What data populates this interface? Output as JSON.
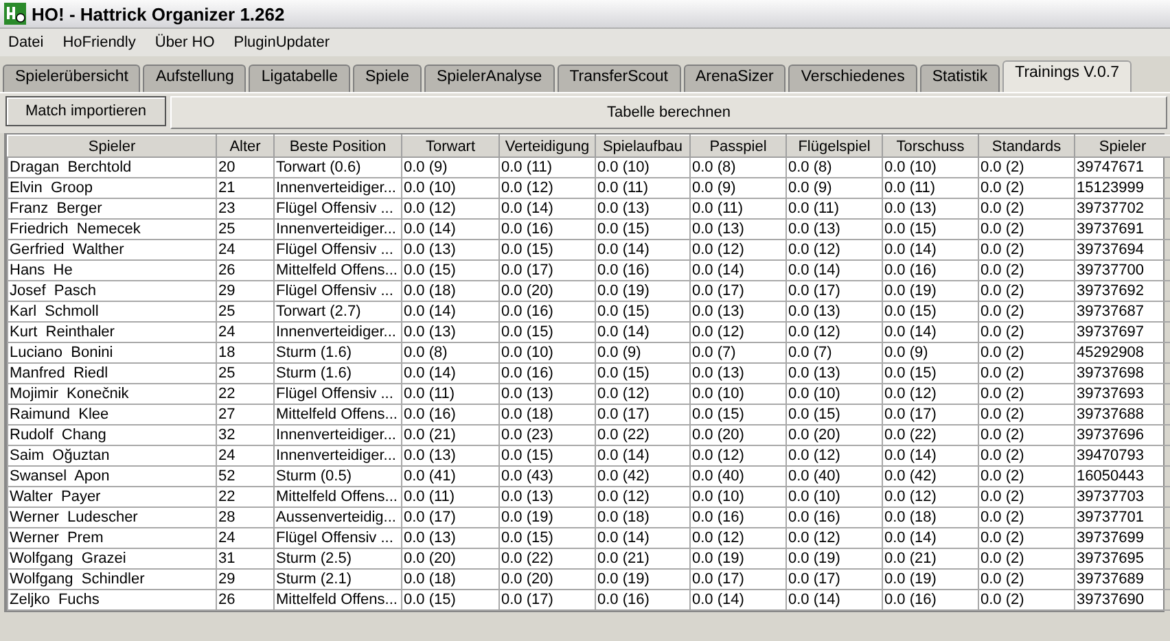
{
  "window": {
    "title": "HO! - Hattrick Organizer 1.262"
  },
  "menu": [
    "Datei",
    "HoFriendly",
    "Über HO",
    "PluginUpdater"
  ],
  "tabs": [
    {
      "label": "Spielerübersicht",
      "selected": false
    },
    {
      "label": "Aufstellung",
      "selected": false
    },
    {
      "label": "Ligatabelle",
      "selected": false
    },
    {
      "label": "Spiele",
      "selected": false
    },
    {
      "label": "SpielerAnalyse",
      "selected": false
    },
    {
      "label": "TransferScout",
      "selected": false
    },
    {
      "label": "ArenaSizer",
      "selected": false
    },
    {
      "label": "Verschiedenes",
      "selected": false
    },
    {
      "label": "Statistik",
      "selected": false
    },
    {
      "label": "Trainings V.0.7",
      "selected": true
    }
  ],
  "toolbar": {
    "import_button": "Match importieren",
    "calculate_label": "Tabelle berechnen"
  },
  "table": {
    "columns": [
      "Spieler",
      "Alter",
      "Beste Position",
      "Torwart",
      "Verteidigung",
      "Spielaufbau",
      "Passpiel",
      "Flügelspiel",
      "Torschuss",
      "Standards",
      "Spieler"
    ],
    "rows": [
      [
        "Dragan  Berchtold",
        "20",
        "Torwart (0.6)",
        "0.0 (9)",
        "0.0 (11)",
        "0.0 (10)",
        "0.0 (8)",
        "0.0 (8)",
        "0.0 (10)",
        "0.0 (2)",
        "39747671"
      ],
      [
        "Elvin  Groop",
        "21",
        "Innenverteidiger...",
        "0.0 (10)",
        "0.0 (12)",
        "0.0 (11)",
        "0.0 (9)",
        "0.0 (9)",
        "0.0 (11)",
        "0.0 (2)",
        "15123999"
      ],
      [
        "Franz  Berger",
        "23",
        "Flügel Offensiv ...",
        "0.0 (12)",
        "0.0 (14)",
        "0.0 (13)",
        "0.0 (11)",
        "0.0 (11)",
        "0.0 (13)",
        "0.0 (2)",
        "39737702"
      ],
      [
        "Friedrich  Nemecek",
        "25",
        "Innenverteidiger...",
        "0.0 (14)",
        "0.0 (16)",
        "0.0 (15)",
        "0.0 (13)",
        "0.0 (13)",
        "0.0 (15)",
        "0.0 (2)",
        "39737691"
      ],
      [
        "Gerfried  Walther",
        "24",
        "Flügel Offensiv ...",
        "0.0 (13)",
        "0.0 (15)",
        "0.0 (14)",
        "0.0 (12)",
        "0.0 (12)",
        "0.0 (14)",
        "0.0 (2)",
        "39737694"
      ],
      [
        "Hans  He",
        "26",
        "Mittelfeld Offens...",
        "0.0 (15)",
        "0.0 (17)",
        "0.0 (16)",
        "0.0 (14)",
        "0.0 (14)",
        "0.0 (16)",
        "0.0 (2)",
        "39737700"
      ],
      [
        "Josef  Pasch",
        "29",
        "Flügel Offensiv ...",
        "0.0 (18)",
        "0.0 (20)",
        "0.0 (19)",
        "0.0 (17)",
        "0.0 (17)",
        "0.0 (19)",
        "0.0 (2)",
        "39737692"
      ],
      [
        "Karl  Schmoll",
        "25",
        "Torwart (2.7)",
        "0.0 (14)",
        "0.0 (16)",
        "0.0 (15)",
        "0.0 (13)",
        "0.0 (13)",
        "0.0 (15)",
        "0.0 (2)",
        "39737687"
      ],
      [
        "Kurt  Reinthaler",
        "24",
        "Innenverteidiger...",
        "0.0 (13)",
        "0.0 (15)",
        "0.0 (14)",
        "0.0 (12)",
        "0.0 (12)",
        "0.0 (14)",
        "0.0 (2)",
        "39737697"
      ],
      [
        "Luciano  Bonini",
        "18",
        "Sturm (1.6)",
        "0.0 (8)",
        "0.0 (10)",
        "0.0 (9)",
        "0.0 (7)",
        "0.0 (7)",
        "0.0 (9)",
        "0.0 (2)",
        "45292908"
      ],
      [
        "Manfred  Riedl",
        "25",
        "Sturm (1.6)",
        "0.0 (14)",
        "0.0 (16)",
        "0.0 (15)",
        "0.0 (13)",
        "0.0 (13)",
        "0.0 (15)",
        "0.0 (2)",
        "39737698"
      ],
      [
        "Mojimir  Konečnik",
        "22",
        "Flügel Offensiv ...",
        "0.0 (11)",
        "0.0 (13)",
        "0.0 (12)",
        "0.0 (10)",
        "0.0 (10)",
        "0.0 (12)",
        "0.0 (2)",
        "39737693"
      ],
      [
        "Raimund  Klee",
        "27",
        "Mittelfeld Offens...",
        "0.0 (16)",
        "0.0 (18)",
        "0.0 (17)",
        "0.0 (15)",
        "0.0 (15)",
        "0.0 (17)",
        "0.0 (2)",
        "39737688"
      ],
      [
        "Rudolf  Chang",
        "32",
        "Innenverteidiger...",
        "0.0 (21)",
        "0.0 (23)",
        "0.0 (22)",
        "0.0 (20)",
        "0.0 (20)",
        "0.0 (22)",
        "0.0 (2)",
        "39737696"
      ],
      [
        "Saim  Oğuztan",
        "24",
        "Innenverteidiger...",
        "0.0 (13)",
        "0.0 (15)",
        "0.0 (14)",
        "0.0 (12)",
        "0.0 (12)",
        "0.0 (14)",
        "0.0 (2)",
        "39470793"
      ],
      [
        "Swansel  Apon",
        "52",
        "Sturm (0.5)",
        "0.0 (41)",
        "0.0 (43)",
        "0.0 (42)",
        "0.0 (40)",
        "0.0 (40)",
        "0.0 (42)",
        "0.0 (2)",
        "16050443"
      ],
      [
        "Walter  Payer",
        "22",
        "Mittelfeld Offens...",
        "0.0 (11)",
        "0.0 (13)",
        "0.0 (12)",
        "0.0 (10)",
        "0.0 (10)",
        "0.0 (12)",
        "0.0 (2)",
        "39737703"
      ],
      [
        "Werner  Ludescher",
        "28",
        "Aussenverteidig...",
        "0.0 (17)",
        "0.0 (19)",
        "0.0 (18)",
        "0.0 (16)",
        "0.0 (16)",
        "0.0 (18)",
        "0.0 (2)",
        "39737701"
      ],
      [
        "Werner  Prem",
        "24",
        "Flügel Offensiv ...",
        "0.0 (13)",
        "0.0 (15)",
        "0.0 (14)",
        "0.0 (12)",
        "0.0 (12)",
        "0.0 (14)",
        "0.0 (2)",
        "39737699"
      ],
      [
        "Wolfgang  Grazei",
        "31",
        "Sturm (2.5)",
        "0.0 (20)",
        "0.0 (22)",
        "0.0 (21)",
        "0.0 (19)",
        "0.0 (19)",
        "0.0 (21)",
        "0.0 (2)",
        "39737695"
      ],
      [
        "Wolfgang  Schindler",
        "29",
        "Sturm (2.1)",
        "0.0 (18)",
        "0.0 (20)",
        "0.0 (19)",
        "0.0 (17)",
        "0.0 (17)",
        "0.0 (19)",
        "0.0 (2)",
        "39737689"
      ],
      [
        "Zeljko  Fuchs",
        "26",
        "Mittelfeld Offens...",
        "0.0 (15)",
        "0.0 (17)",
        "0.0 (16)",
        "0.0 (14)",
        "0.0 (14)",
        "0.0 (16)",
        "0.0 (2)",
        "39737690"
      ]
    ]
  }
}
